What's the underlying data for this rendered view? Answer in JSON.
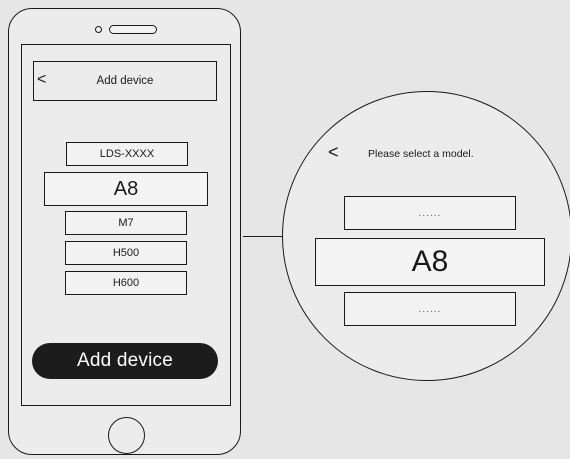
{
  "phone": {
    "appbar": {
      "back_icon": "<",
      "title": "Add device"
    },
    "models": {
      "top": "LDS-XXXX",
      "selected": "A8",
      "m7": "M7",
      "h500": "H500",
      "h600": "H600"
    },
    "add_button": "Add device"
  },
  "zoom": {
    "back_icon": "<",
    "title": "Please select a model.",
    "option_above": "......",
    "selected": "A8",
    "option_below": "......"
  }
}
